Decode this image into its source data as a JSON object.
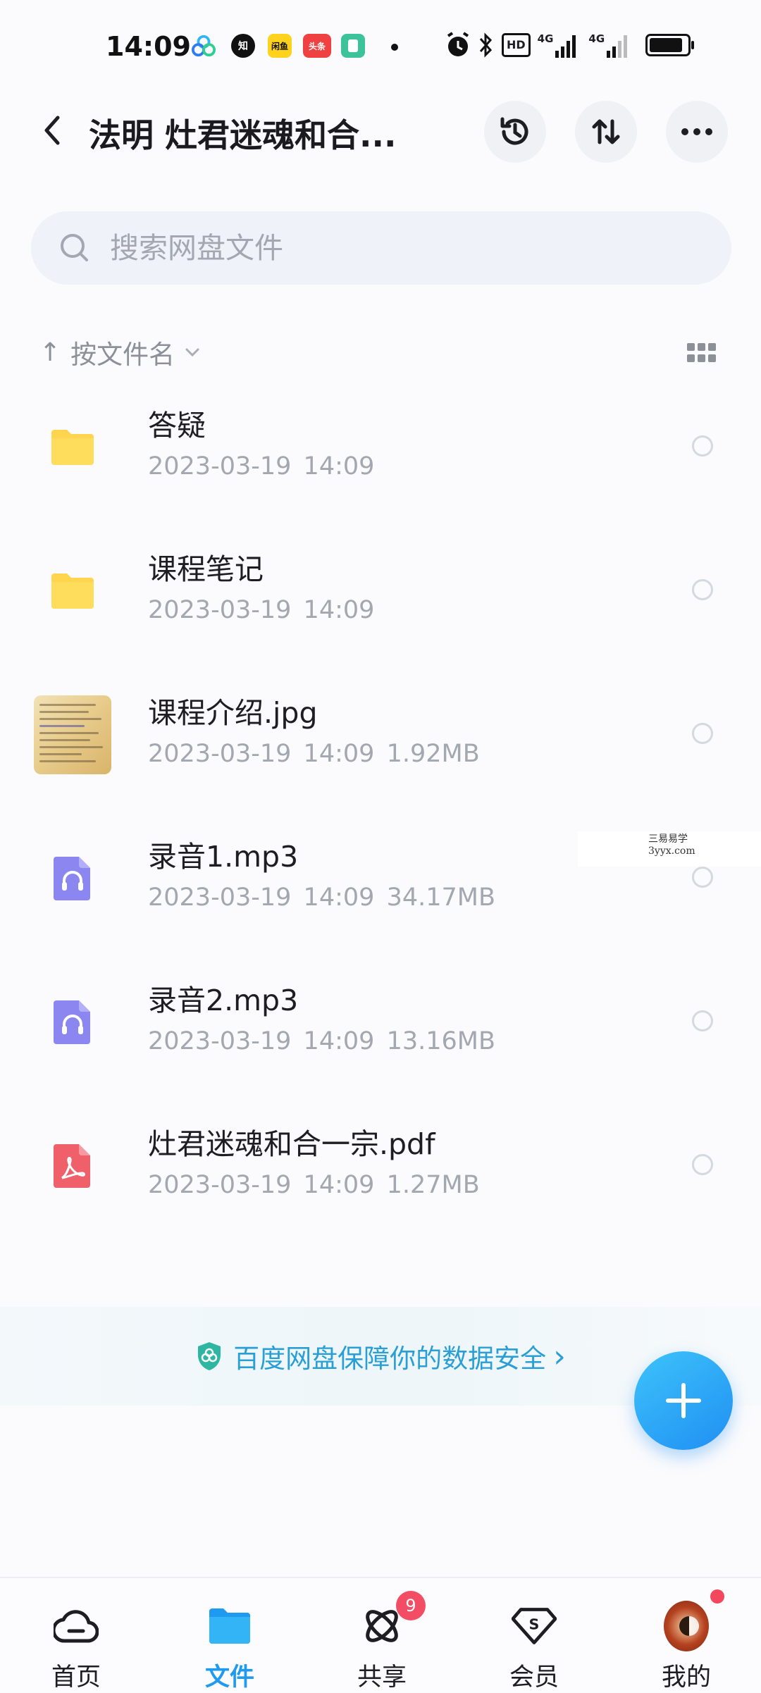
{
  "status_bar": {
    "time": "14:09",
    "app_icons": [
      {
        "name": "baidu-netdisk-icon",
        "text": "",
        "color": "#3aa0f3"
      },
      {
        "name": "zhihu-icon",
        "text": "知",
        "color": "#111111"
      },
      {
        "name": "xianyu-icon",
        "text": "闲鱼",
        "color": "#ffd21e"
      },
      {
        "name": "toutiao-icon",
        "text": "头条",
        "color": "#f04142"
      },
      {
        "name": "notes-app-icon",
        "text": "",
        "color": "#3cc39c"
      }
    ],
    "right_icons": [
      "alarm-icon",
      "bluetooth-icon",
      "hd-icon",
      "signal-4g-icon",
      "signal-4g-icon",
      "battery-icon"
    ],
    "hd_label": "HD",
    "network_label_1": "4G",
    "network_label_2": "4G"
  },
  "header": {
    "title": "法明 灶君迷魂和合...",
    "icons": [
      "back-arrow-icon",
      "history-icon",
      "sort-toggle-icon",
      "more-icon"
    ]
  },
  "search": {
    "placeholder": "搜索网盘文件"
  },
  "sort_bar": {
    "label": "按文件名",
    "arrow": "↑"
  },
  "files": [
    {
      "name": "答疑",
      "date": "2023-03-19",
      "time": "14:09",
      "size": "",
      "type": "folder"
    },
    {
      "name": "课程笔记",
      "date": "2023-03-19",
      "time": "14:09",
      "size": "",
      "type": "folder"
    },
    {
      "name": "课程介绍.jpg",
      "date": "2023-03-19",
      "time": "14:09",
      "size": "1.92MB",
      "type": "image"
    },
    {
      "name": "录音1.mp3",
      "date": "2023-03-19",
      "time": "14:09",
      "size": "34.17MB",
      "type": "audio"
    },
    {
      "name": "录音2.mp3",
      "date": "2023-03-19",
      "time": "14:09",
      "size": "13.16MB",
      "type": "audio"
    },
    {
      "name": "灶君迷魂和合一宗.pdf",
      "date": "2023-03-19",
      "time": "14:09",
      "size": "1.27MB",
      "type": "pdf"
    }
  ],
  "watermark": {
    "line1": "三易易学",
    "line2": "3yyx.com"
  },
  "safety_banner": {
    "text": "百度网盘保障你的数据安全",
    "arrow": "›"
  },
  "bottom_nav": [
    {
      "label": "首页",
      "icon": "cloud-home-icon",
      "active": false
    },
    {
      "label": "文件",
      "icon": "folder-icon",
      "active": true
    },
    {
      "label": "共享",
      "icon": "share-orbit-icon",
      "active": false,
      "badge": "9"
    },
    {
      "label": "会员",
      "icon": "vip-diamond-icon",
      "active": false
    },
    {
      "label": "我的",
      "icon": "avatar",
      "active": false
    }
  ],
  "colors": {
    "accent": "#1e9bf0",
    "folder": "#ffd54f",
    "audio": "#8b86f0",
    "pdf": "#f0606b",
    "badge": "#f24d64"
  }
}
